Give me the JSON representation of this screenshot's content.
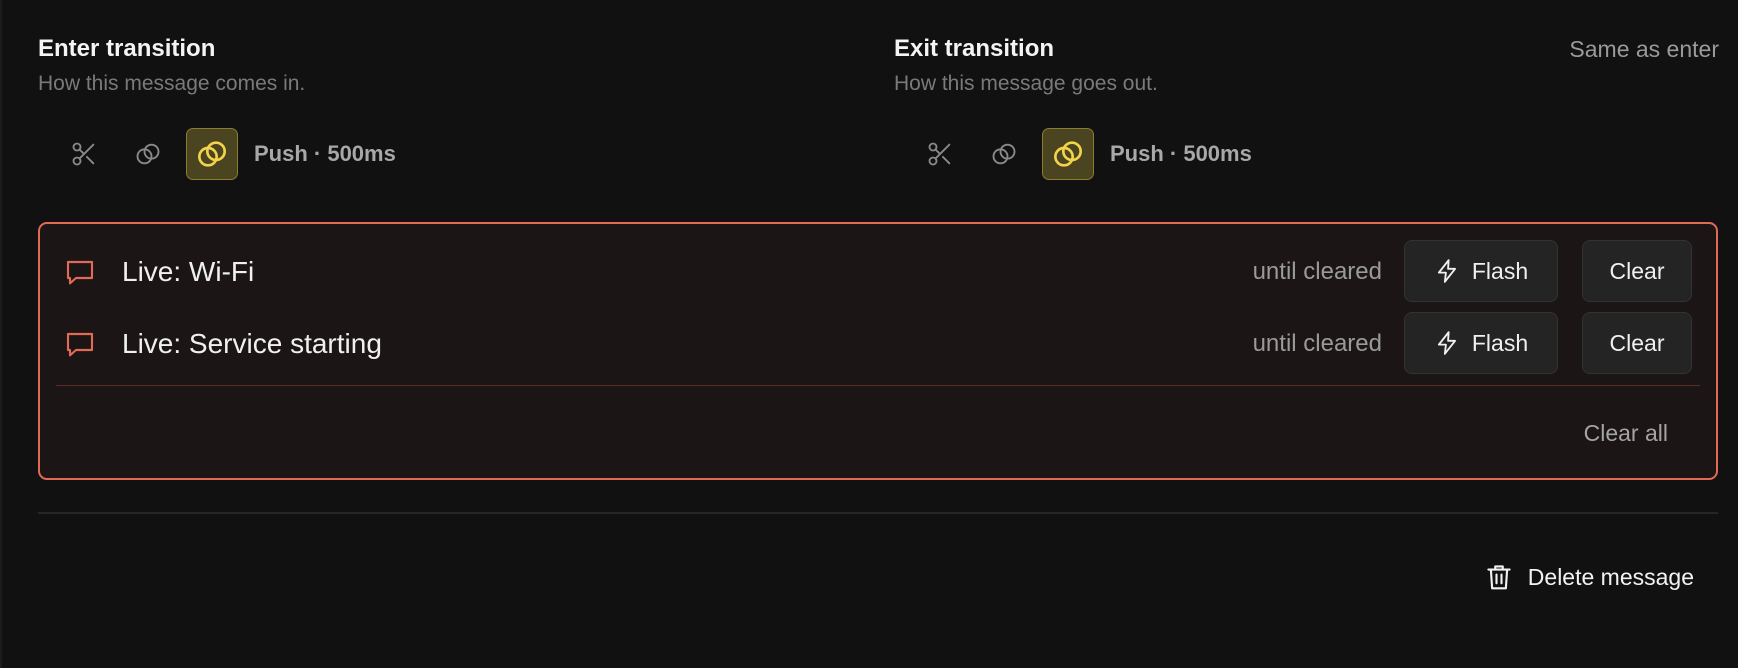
{
  "enter": {
    "title": "Enter transition",
    "subtitle": "How this message comes in.",
    "tools": [
      {
        "icon": "scissors-icon",
        "active": false
      },
      {
        "icon": "crossfade-icon",
        "active": false
      },
      {
        "icon": "push-icon",
        "active": true
      }
    ],
    "selected_label": "Push · 500ms"
  },
  "exit": {
    "title": "Exit transition",
    "subtitle": "How this message goes out.",
    "same_as_label": "Same as enter",
    "tools": [
      {
        "icon": "scissors-icon",
        "active": false
      },
      {
        "icon": "crossfade-icon",
        "active": false
      },
      {
        "icon": "push-icon",
        "active": true
      }
    ],
    "selected_label": "Push · 500ms"
  },
  "live": {
    "items": [
      {
        "icon": "message-bubble-icon",
        "label": "Live: Wi-Fi",
        "status": "until cleared",
        "flash_label": "Flash",
        "clear_label": "Clear"
      },
      {
        "icon": "message-bubble-icon",
        "label": "Live: Service starting",
        "status": "until cleared",
        "flash_label": "Flash",
        "clear_label": "Clear"
      }
    ],
    "clear_all_label": "Clear all"
  },
  "delete_label": "Delete message",
  "colors": {
    "accent_border": "#e06a55",
    "active_tool_bg": "#4a4420",
    "active_tool_icon": "#f2d34a"
  }
}
